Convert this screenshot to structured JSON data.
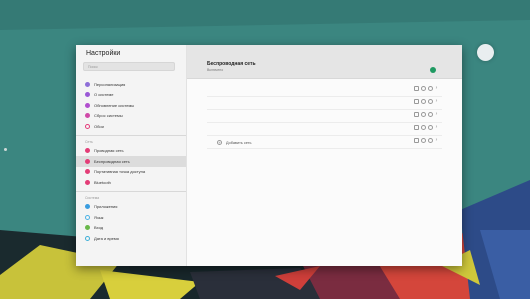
{
  "desktop": {
    "topbar_text": "",
    "dock_text": "",
    "colors": {
      "teal": "#3f8b86",
      "dark": "#142024",
      "yellow": "#c9c43a",
      "red": "#d2433c",
      "blue": "#2f4c8a"
    }
  },
  "window": {
    "title": "Настройки",
    "search_placeholder": "Поиск",
    "sidebar": {
      "group1": [
        {
          "label": "Персонализация",
          "color": "#8e6fd8"
        },
        {
          "label": "О системе",
          "color": "#9a59d6"
        },
        {
          "label": "Обновление системы",
          "color": "#b14fcf"
        },
        {
          "label": "Сброс системы",
          "color": "#d04aa8"
        },
        {
          "label": "Обои",
          "color": "#e43c7a",
          "ring": true
        }
      ],
      "group2_header": "Сеть",
      "group2": [
        {
          "label": "Проводная сеть",
          "color": "#e33d77"
        },
        {
          "label": "Беспроводная сеть",
          "color": "#e33d77",
          "active": true
        },
        {
          "label": "Портативная точка доступа",
          "color": "#e33d77"
        },
        {
          "label": "Bluetooth",
          "color": "#e33d77"
        }
      ],
      "group3_header": "Система",
      "group3": [
        {
          "label": "Приложения",
          "color": "#3a9de0"
        },
        {
          "label": "Язык",
          "color": "#4cb3e6",
          "ring": true
        },
        {
          "label": "Вход",
          "color": "#69b84a"
        },
        {
          "label": "Дата и время",
          "color": "#3fb0d8",
          "ring": true
        }
      ]
    },
    "main": {
      "title": "Беспроводная сеть",
      "subtitle": "Включено",
      "toggle_color": "#1f9a62",
      "add_network_label": "Добавить сеть"
    }
  }
}
